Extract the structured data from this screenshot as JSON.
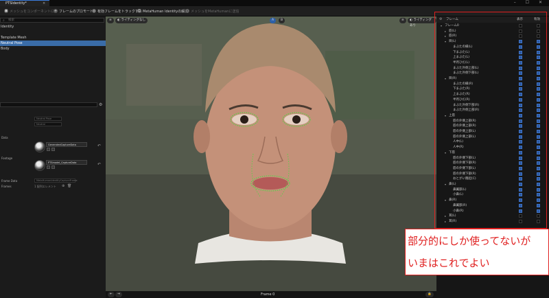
{
  "window": {
    "tab_title": "PTSIdentity*",
    "tab_close": "×",
    "controls": "– ☐ ✕"
  },
  "toolbar": {
    "items": [
      {
        "label": "メッシュをコンポーネントに",
        "icon": "mesh-icon",
        "enabled": false
      },
      {
        "label": "フレームのプロモート",
        "icon": "plus-icon",
        "enabled": true
      },
      {
        "label": "有効フレームをトラックする",
        "icon": "track-icon",
        "enabled": true
      },
      {
        "label": "MetaHuman Identityの解決",
        "icon": "identity-icon",
        "enabled": true
      },
      {
        "label": "メッシュをMetaHumanに送信",
        "icon": "send-icon",
        "enabled": false
      }
    ]
  },
  "left_panel": {
    "search_placeholder": "検索",
    "tree": [
      "Identity",
      "Template Mesh",
      "Neutral Pose",
      "Body"
    ],
    "selected_index": 2,
    "details": {
      "rows": [
        {
          "label": "",
          "value": "Neutral Pose"
        },
        {
          "label": "",
          "value": "Neutral"
        },
        {
          "label": "Data",
          "value": ""
        },
        {
          "label": "Footage",
          "value": ""
        }
      ],
      "asset1": "GeneratedCaptureData",
      "asset2": "PTSmodel_CaptureData",
      "frame_data_label": "Frame Data",
      "frame_data_value": "MetaHumanIdentityCaptureFrame",
      "frames_label": "Frames",
      "frames_value": "1 配列エレメント"
    }
  },
  "viewport": {
    "lighting_label": "ライティングなし",
    "lighting_label_right": "ライティングあり",
    "frame_label": "Frame 0"
  },
  "right_panel": {
    "col_frame": "フレーム",
    "col_visible": "表示",
    "col_active": "有効",
    "rows": [
      {
        "label": "フレーム0",
        "indent": 0,
        "arrow": "▾",
        "visible": false,
        "active": false
      },
      {
        "label": "唇(L)",
        "indent": 1,
        "arrow": "▸",
        "visible": false,
        "active": false
      },
      {
        "label": "唇(R)",
        "indent": 1,
        "arrow": "▸",
        "visible": false,
        "active": false
      },
      {
        "label": "目(L)",
        "indent": 1,
        "arrow": "▾",
        "visible": true,
        "active": true
      },
      {
        "label": "まぶたの縁(L)",
        "indent": 2,
        "arrow": "",
        "visible": true,
        "active": true
      },
      {
        "label": "下まぶた(L)",
        "indent": 2,
        "arrow": "",
        "visible": true,
        "active": true
      },
      {
        "label": "上まぶた(L)",
        "indent": 2,
        "arrow": "",
        "visible": true,
        "active": true
      },
      {
        "label": "半月ひだ(L)",
        "indent": 2,
        "arrow": "",
        "visible": true,
        "active": true
      },
      {
        "label": "まぶた外側上部(L)",
        "indent": 2,
        "arrow": "",
        "visible": true,
        "active": true
      },
      {
        "label": "まぶた外側下部(L)",
        "indent": 2,
        "arrow": "",
        "visible": true,
        "active": true
      },
      {
        "label": "目(R)",
        "indent": 1,
        "arrow": "▾",
        "visible": true,
        "active": true
      },
      {
        "label": "まぶたの縁(R)",
        "indent": 2,
        "arrow": "",
        "visible": true,
        "active": true
      },
      {
        "label": "下まぶた(R)",
        "indent": 2,
        "arrow": "",
        "visible": true,
        "active": true
      },
      {
        "label": "上まぶた(R)",
        "indent": 2,
        "arrow": "",
        "visible": true,
        "active": true
      },
      {
        "label": "半月ひだ(R)",
        "indent": 2,
        "arrow": "",
        "visible": true,
        "active": true
      },
      {
        "label": "まぶた外側下部(R)",
        "indent": 2,
        "arrow": "",
        "visible": true,
        "active": true
      },
      {
        "label": "まぶた外側上部(R)",
        "indent": 2,
        "arrow": "",
        "visible": true,
        "active": true
      },
      {
        "label": "上唇",
        "indent": 1,
        "arrow": "▾",
        "visible": true,
        "active": true
      },
      {
        "label": "唇の外側上部(R)",
        "indent": 2,
        "arrow": "",
        "visible": true,
        "active": true
      },
      {
        "label": "唇の外側上部(R)",
        "indent": 2,
        "arrow": "",
        "visible": true,
        "active": true
      },
      {
        "label": "唇の外側上部(L)",
        "indent": 2,
        "arrow": "",
        "visible": true,
        "active": true
      },
      {
        "label": "唇の外側上部(L)",
        "indent": 2,
        "arrow": "",
        "visible": true,
        "active": true
      },
      {
        "label": "人中(L)",
        "indent": 2,
        "arrow": "",
        "visible": true,
        "active": true
      },
      {
        "label": "人中(R)",
        "indent": 2,
        "arrow": "",
        "visible": true,
        "active": true
      },
      {
        "label": "下唇",
        "indent": 1,
        "arrow": "▾",
        "visible": true,
        "active": true
      },
      {
        "label": "唇の外側下部(L)",
        "indent": 2,
        "arrow": "",
        "visible": true,
        "active": true
      },
      {
        "label": "唇の外側下部(R)",
        "indent": 2,
        "arrow": "",
        "visible": true,
        "active": true
      },
      {
        "label": "唇の外側下部(L)",
        "indent": 2,
        "arrow": "",
        "visible": true,
        "active": true
      },
      {
        "label": "唇の外側下部(R)",
        "indent": 2,
        "arrow": "",
        "visible": true,
        "active": true
      },
      {
        "label": "おとがい隆起(C)",
        "indent": 2,
        "arrow": "",
        "visible": true,
        "active": true
      },
      {
        "label": "鼻(L)",
        "indent": 1,
        "arrow": "▾",
        "visible": true,
        "active": true
      },
      {
        "label": "鼻翼部(L)",
        "indent": 2,
        "arrow": "",
        "visible": true,
        "active": true
      },
      {
        "label": "小鼻(L)",
        "indent": 2,
        "arrow": "",
        "visible": true,
        "active": true
      },
      {
        "label": "鼻(R)",
        "indent": 1,
        "arrow": "▾",
        "visible": true,
        "active": true
      },
      {
        "label": "鼻翼部(R)",
        "indent": 2,
        "arrow": "",
        "visible": true,
        "active": true
      },
      {
        "label": "小鼻(R)",
        "indent": 2,
        "arrow": "",
        "visible": true,
        "active": true
      },
      {
        "label": "耳(L)",
        "indent": 1,
        "arrow": "▸",
        "visible": false,
        "active": false
      },
      {
        "label": "耳(R)",
        "indent": 1,
        "arrow": "▸",
        "visible": false,
        "active": false
      }
    ]
  },
  "annotation": {
    "line1": "部分的にしか使ってないが",
    "line2": "いまはこれでよい",
    "color": "#e02020"
  }
}
